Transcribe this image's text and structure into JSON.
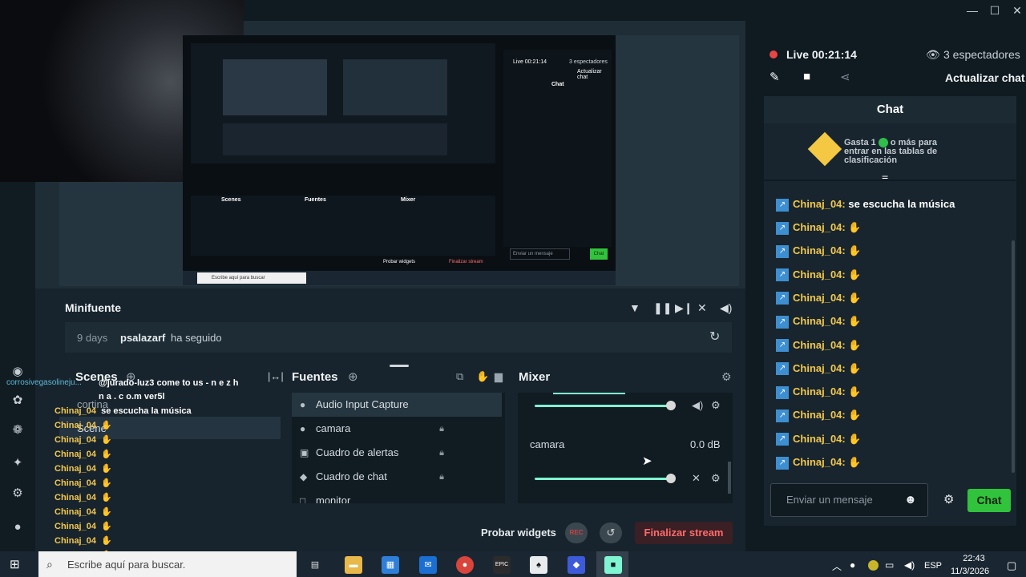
{
  "window": {
    "minimize": "—",
    "maximize": "☐",
    "close": "✕"
  },
  "preview": {
    "inner_chat_header": "Chat",
    "inner_live": "Live 00:21:14",
    "inner_viewers": "3 espectadores",
    "inner_update": "Actualizar chat",
    "inner_msg_placeholder": "Enviar un mensaje",
    "inner_chat_btn": "Chat",
    "inner_scenes": "Scenes",
    "inner_fuentes": "Fuentes",
    "inner_mixer": "Mixer",
    "inner_probar": "Probar widgets",
    "inner_finalizar": "Finalizar stream",
    "inner_search": "Escribe aquí para buscar"
  },
  "minifuente": {
    "title": "Minifuente",
    "time": "9 days",
    "user": "psalazarf",
    "action": "ha seguido"
  },
  "scenes": {
    "title": "Scenes",
    "items": [
      "cortina",
      "Scene"
    ]
  },
  "fuentes": {
    "title": "Fuentes",
    "items": [
      "Audio Input Capture",
      "camara",
      "Cuadro de alertas",
      "Cuadro de chat",
      "monitor"
    ]
  },
  "mixer": {
    "title": "Mixer",
    "channel": "camara",
    "db": "0.0 dB"
  },
  "bottom": {
    "probar": "Probar widgets",
    "rec": "REC",
    "finalizar": "Finalizar stream"
  },
  "chat": {
    "live": "Live 00:21:14",
    "viewers": "3 espectadores",
    "update": "Actualizar chat",
    "header": "Chat",
    "promo_a": "Gasta 1",
    "promo_b": "o más para entrar en las tablas de clasificación",
    "first_user": "Chinaj_04:",
    "first_msg": "se escucha la música",
    "repeated_user": "Chinaj_04:",
    "placeholder": "Enviar un mensaje",
    "send": "Chat",
    "repeat_count": 11
  },
  "overlay": {
    "tag": "corrosivegasolineju...",
    "line1_user": "@jurado-luz3 come to us - n e z h",
    "line1_cont": "n a . c o.m ver5l",
    "line2_user": "Chinaj_04",
    "line2_msg": "se escucha la música",
    "sender": "Chinaj_04"
  },
  "taskbar": {
    "search": "Escribe aquí para buscar.",
    "lang": "ESP",
    "time": "22:43",
    "date": "11/3/2026"
  },
  "colors": {
    "accent": "#80f5d2",
    "send_green": "#31c33c",
    "username": "#f2c84b",
    "end_red": "#e24a4a"
  }
}
